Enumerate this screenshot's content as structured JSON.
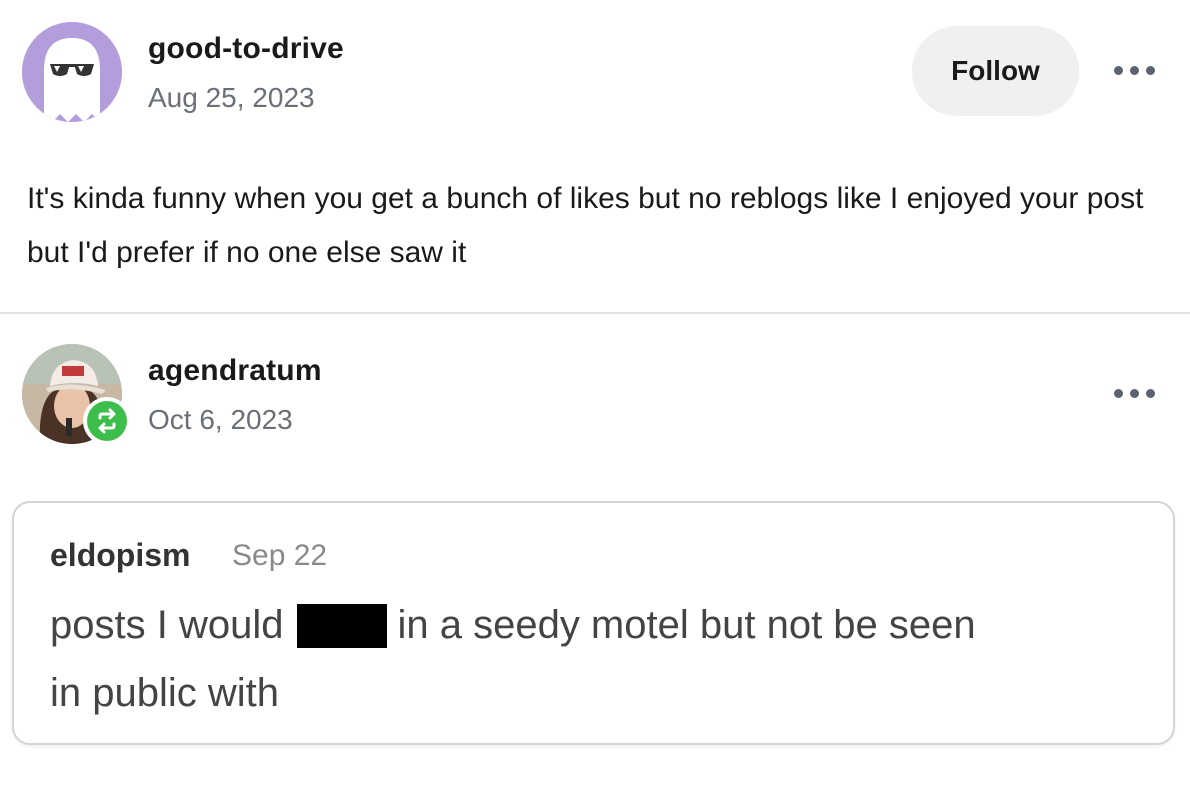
{
  "post1": {
    "username": "good-to-drive",
    "date": "Aug 25, 2023",
    "follow_label": "Follow",
    "body": "It's kinda funny when you get a bunch of likes but no reblogs like I enjoyed your post but I'd prefer if no one else saw it",
    "avatar_color": "#b39ddb"
  },
  "post2": {
    "username": "agendratum",
    "date": "Oct 6, 2023",
    "badge_color": "#3cbf4a",
    "badge_icon": "reblog-icon"
  },
  "quote": {
    "username": "eldopism",
    "date": "Sep 22",
    "line1_before": "posts I would",
    "line1_after": "in a seedy motel but not be seen",
    "line2": "in public with"
  },
  "icons": {
    "more": "more-options-icon"
  }
}
